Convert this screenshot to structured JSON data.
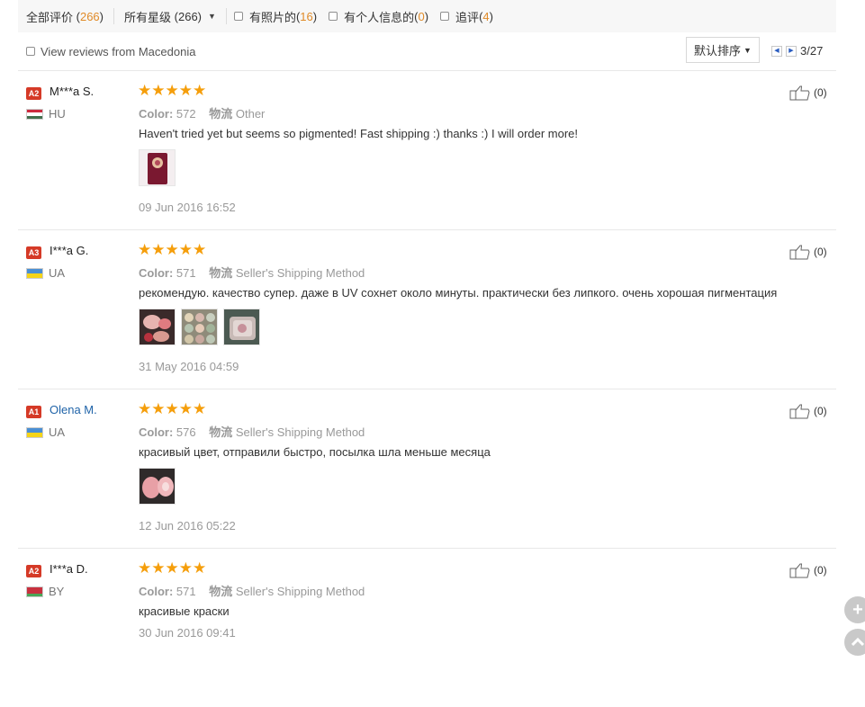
{
  "filters": {
    "all": {
      "label": "全部评价",
      "count": "266"
    },
    "stars": {
      "label": "所有星级",
      "count": "(266)"
    },
    "photo": {
      "label": "有照片的",
      "count": "16"
    },
    "personal": {
      "label": "有个人信息的",
      "count": "0"
    },
    "followup": {
      "label": "追评",
      "count": "4"
    }
  },
  "toolbar": {
    "view_from": "View reviews from Macedonia",
    "sort_label": "默认排序",
    "page": "3/27"
  },
  "reviews": [
    {
      "badge": "A2",
      "name": "M***a S.",
      "country": "HU",
      "color_label": "Color:",
      "color": "572",
      "ship_label": "物流",
      "ship": "Other",
      "text": "Haven't tried yet but seems so pigmented! Fast shipping :) thanks :) I will order more!",
      "date": "09 Jun 2016 16:52",
      "likes": "(0)",
      "rating": 5
    },
    {
      "badge": "A3",
      "name": "I***a G.",
      "country": "UA",
      "color_label": "Color:",
      "color": "571",
      "ship_label": "物流",
      "ship": "Seller's Shipping Method",
      "text": "рекомендую. качество супер. даже в UV сохнет около минуты. практически без липкого. очень хорошая пигментация",
      "date": "31 May 2016 04:59",
      "likes": "(0)",
      "rating": 5
    },
    {
      "badge": "A1",
      "name": "Olena M.",
      "country": "UA",
      "color_label": "Color:",
      "color": "576",
      "ship_label": "物流",
      "ship": "Seller's Shipping Method",
      "text": "красивый цвет, отправили быстро, посылка шла меньше месяца",
      "date": "12 Jun 2016 05:22",
      "likes": "(0)",
      "rating": 5
    },
    {
      "badge": "A2",
      "name": "I***a D.",
      "country": "BY",
      "color_label": "Color:",
      "color": "571",
      "ship_label": "物流",
      "ship": "Seller's Shipping Method",
      "text": "красивые краски",
      "date": "30 Jun 2016 09:41",
      "likes": "(0)",
      "rating": 5
    }
  ],
  "colors": {
    "star": "#f59e0b",
    "badge": "#d53a27",
    "count": "#e08a27",
    "link": "#1f63a8"
  },
  "icons": {
    "like": "thumbs-up-icon",
    "prev": "triangle-left-icon",
    "next": "triangle-right-icon",
    "plus": "plus-icon",
    "up": "chevron-up-icon"
  }
}
